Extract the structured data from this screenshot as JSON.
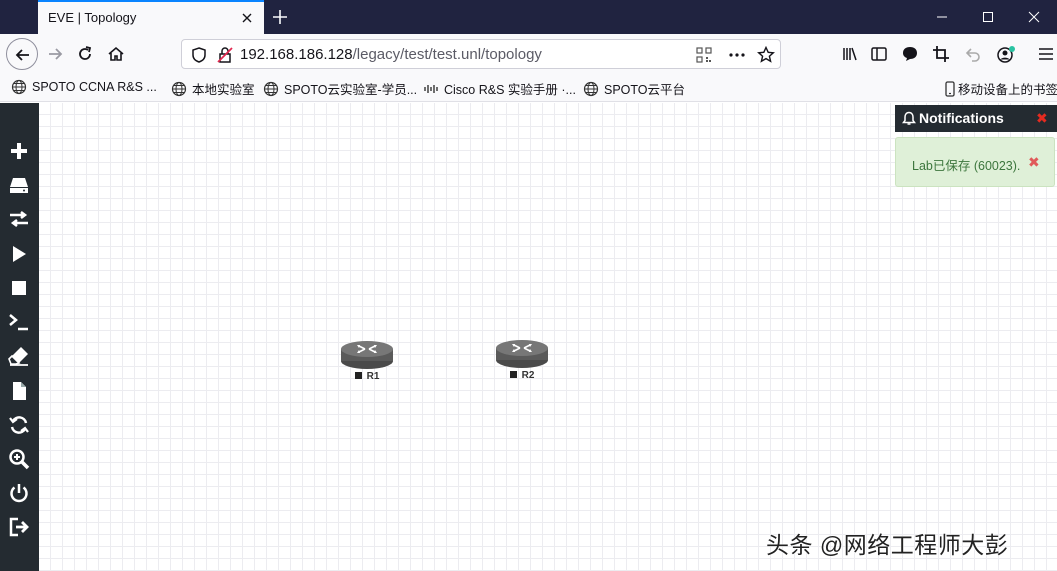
{
  "browser": {
    "tab": {
      "title": "EVE | Topology"
    },
    "url": {
      "host": "192.168.186.128",
      "path": "/legacy/test/test.unl/topology"
    },
    "bookmarks": [
      {
        "label": "SPOTO CCNA R&S ..."
      },
      {
        "label": "本地实验室"
      },
      {
        "label": "SPOTO云实验室-学员..."
      },
      {
        "label": "Cisco R&S 实验手册 ·..."
      },
      {
        "label": "SPOTO云平台"
      }
    ],
    "mobile_bookmarks": "移动设备上的书签"
  },
  "sidebar": {
    "icons": [
      "add-icon",
      "storage-icon",
      "exchange-icon",
      "start-icon",
      "stop-icon",
      "console-icon",
      "eraser-icon",
      "file-icon",
      "refresh-icon",
      "zoom-icon",
      "power-icon",
      "logout-icon"
    ]
  },
  "topology": {
    "nodes": [
      {
        "name": "R1"
      },
      {
        "name": "R2"
      }
    ]
  },
  "notifications": {
    "title": "Notifications",
    "message": "Lab已保存 (60023)."
  },
  "watermark": "头条 @网络工程师大彭",
  "colors": {
    "accent": "#0a84ff",
    "tabstrip": "#202340",
    "sidebar": "#242b31",
    "notif_bg": "#dff0d8",
    "notif_text": "#3c763d"
  }
}
